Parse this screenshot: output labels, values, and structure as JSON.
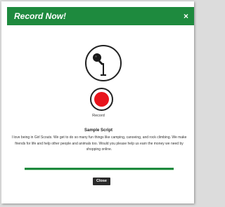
{
  "modal": {
    "title": "Record Now!",
    "close_glyph": "×",
    "header_color": "#1e8a3e"
  },
  "mic": {
    "icon": "microphone-icon"
  },
  "record": {
    "label": "Record",
    "dot_color": "#e8141c"
  },
  "script": {
    "title": "Sample Script",
    "body": "I love being in Girl Scouts. We get to do so many fun things like camping, canoeing, and rock climbing. We make friends for life and help other people and animals too. Would you please help us earn the money we need by shopping online."
  },
  "footer": {
    "close_label": "Close",
    "divider_color": "#1e8a3e"
  }
}
